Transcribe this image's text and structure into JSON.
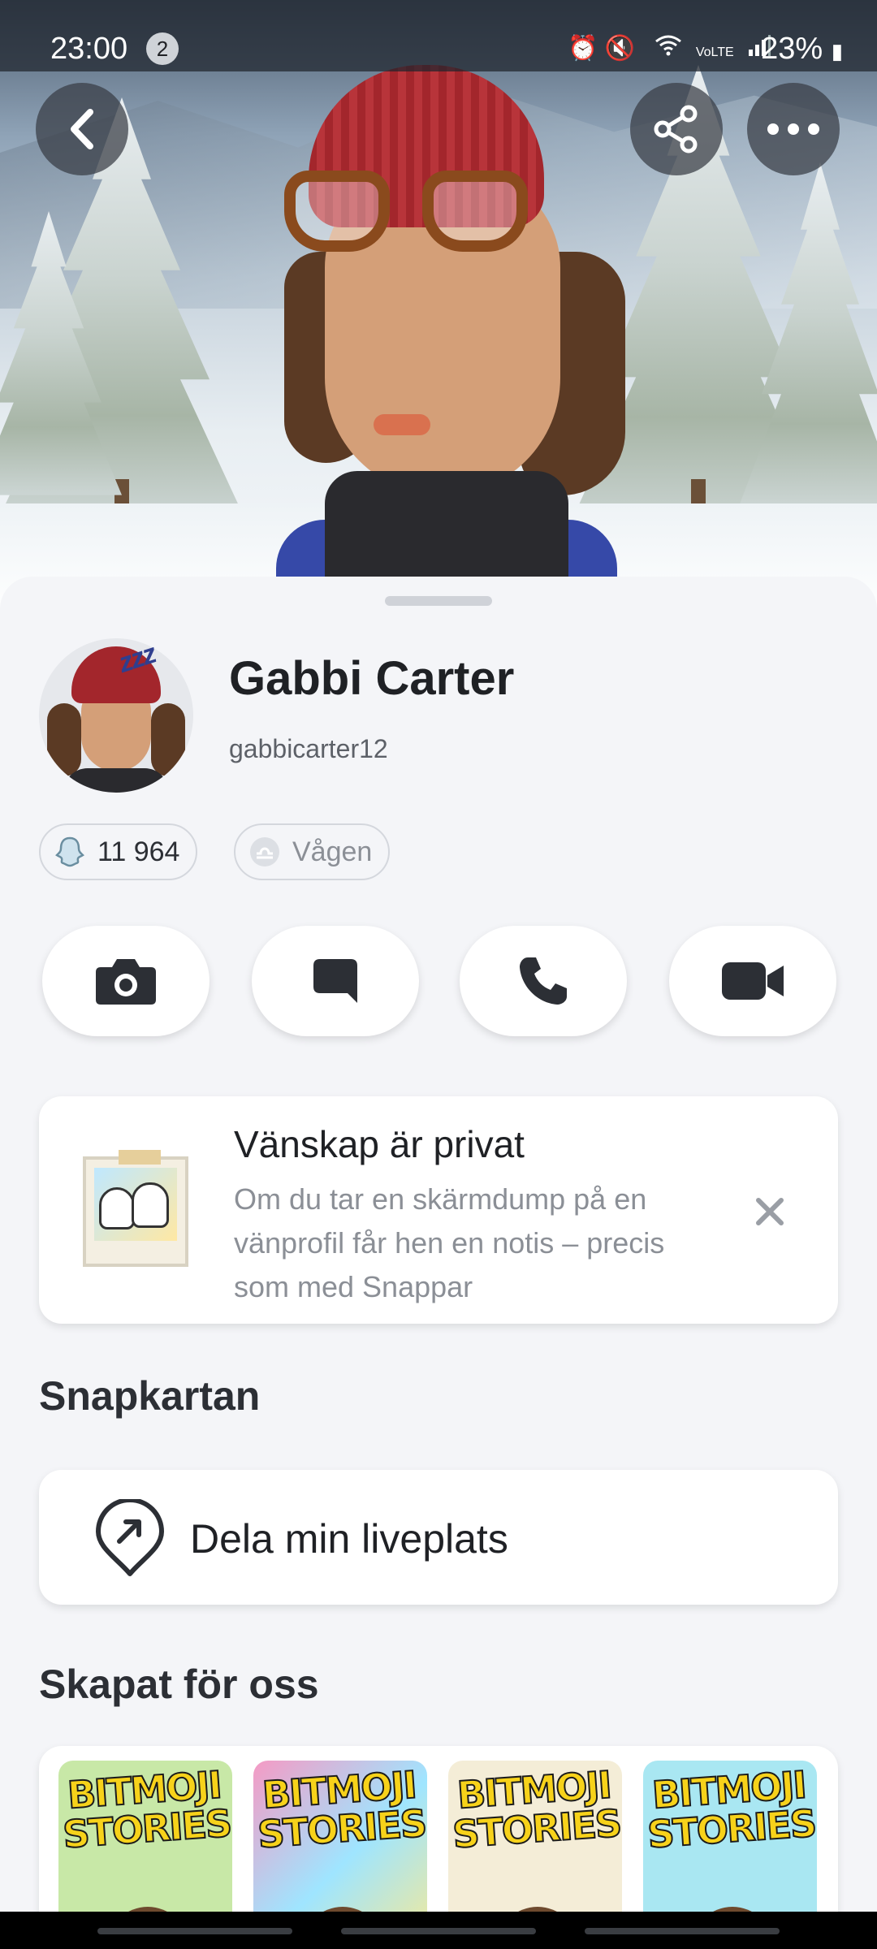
{
  "status_bar": {
    "time": "23:00",
    "notification_count": "2",
    "battery": "23%",
    "indicators": [
      "alarm-icon",
      "mute-icon",
      "wifi-icon",
      "volte-icon",
      "signal-icon"
    ]
  },
  "header": {
    "back_icon": "chevron-left-icon",
    "share_icon": "share-icon",
    "more_icon": "more-horizontal-icon"
  },
  "profile": {
    "display_name": "Gabbi Carter",
    "username": "gabbicarter12",
    "avatar_badge": "zzz",
    "snap_score": "11 964",
    "zodiac": "Vågen"
  },
  "actions": [
    {
      "name": "camera-button",
      "icon": "camera-icon"
    },
    {
      "name": "chat-button",
      "icon": "chat-icon"
    },
    {
      "name": "call-button",
      "icon": "phone-icon"
    },
    {
      "name": "video-call-button",
      "icon": "video-icon"
    }
  ],
  "privacy_notice": {
    "title": "Vänskap är privat",
    "body": "Om du tar en skärmdump på en vänprofil får hen en notis – precis som med Snappar"
  },
  "snap_map": {
    "section_title": "Snapkartan",
    "share_location_label": "Dela min liveplats"
  },
  "created_for_us": {
    "section_title": "Skapat för oss",
    "tiles": [
      {
        "title": "BITMOJI STORIES"
      },
      {
        "title": "BITMOJI STORIES"
      },
      {
        "title": "BITMOJI STORIES"
      },
      {
        "title": "BITMOJI STORIES"
      }
    ]
  },
  "colors": {
    "sheet_background": "#f4f5f8",
    "card_background": "#ffffff",
    "primary_text": "#1f2125",
    "secondary_text": "#8b8f96",
    "icon_color": "#2c2f35"
  }
}
